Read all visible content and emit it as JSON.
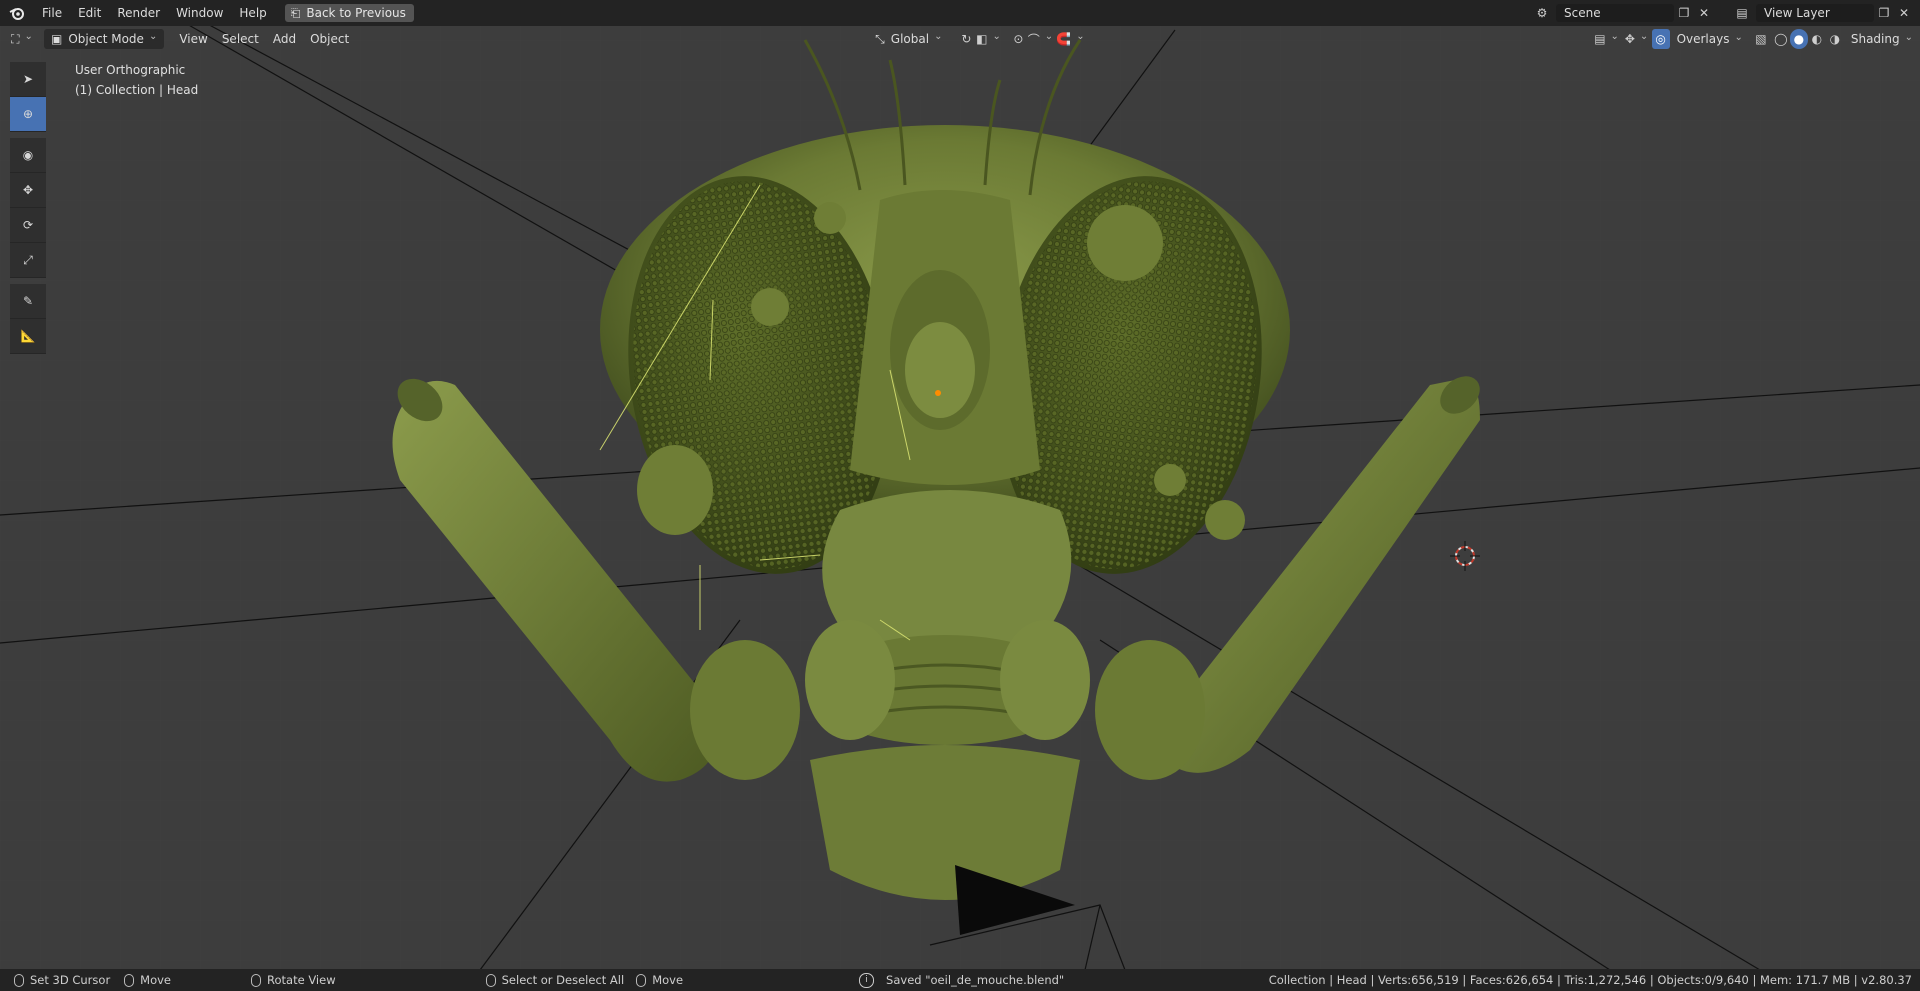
{
  "topbar": {
    "menus": [
      "File",
      "Edit",
      "Render",
      "Window",
      "Help"
    ],
    "back_button": "Back to Previous",
    "scene_name": "Scene",
    "view_layer_name": "View Layer"
  },
  "header": {
    "mode": "Object Mode",
    "menus": [
      "View",
      "Select",
      "Add",
      "Object"
    ],
    "orientation": "Global",
    "overlays": "Overlays",
    "shading": "Shading"
  },
  "viewport": {
    "view_name": "User Orthographic",
    "collection_path": "(1) Collection | Head"
  },
  "toolbar": {
    "tools": [
      "select-icon",
      "cursor-icon",
      "transform-icon",
      "move-icon",
      "rotate-icon",
      "scale-icon",
      "annotate-icon",
      "measure-icon"
    ]
  },
  "statusbar": {
    "left_mouse": "Set 3D Cursor",
    "middle_mouse": "Move",
    "right_mouse": "Rotate View",
    "select_hint": "Select or Deselect All",
    "move_hint": "Move",
    "saved_message": "Saved \"oeil_de_mouche.blend\"",
    "stats": "Collection | Head | Verts:656,519 | Faces:626,654 | Tris:1,272,546 | Objects:0/9,640 | Mem: 171.7 MB | v2.80.37"
  },
  "colors": {
    "accent": "#4772b3",
    "body_green": "#6b7a34",
    "background": "#3d3d3d"
  }
}
